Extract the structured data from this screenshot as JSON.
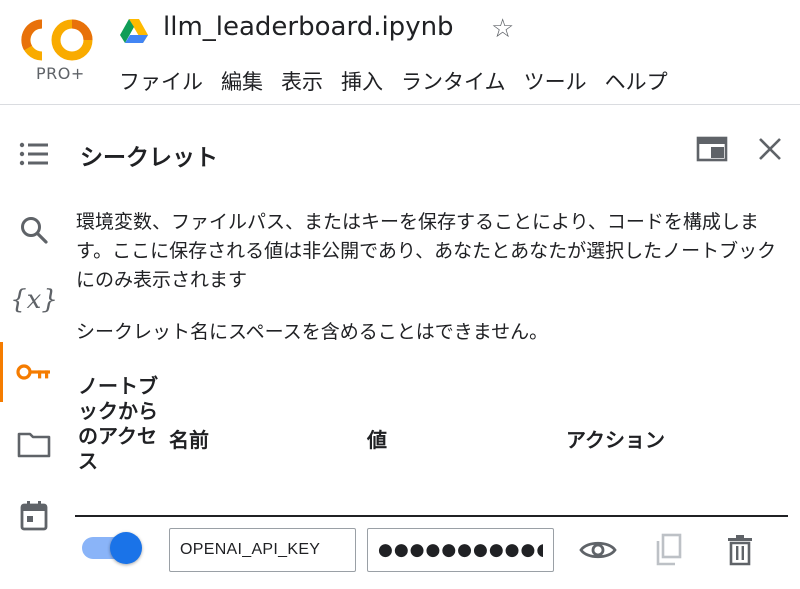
{
  "header": {
    "logo_text": "CO",
    "logo_badge": "PRO+",
    "title": "llm_leaderboard.ipynb",
    "menu": [
      "ファイル",
      "編集",
      "表示",
      "挿入",
      "ランタイム",
      "ツール",
      "ヘルプ"
    ]
  },
  "panel": {
    "title": "シークレット",
    "description": "環境変数、ファイルパス、またはキーを保存することにより、コードを構成します。ここに保存される値は非公開であり、あなたとあなたが選択したノートブックにのみ表示されます",
    "note": "シークレット名にスペースを含めることはできません。"
  },
  "table": {
    "headers": {
      "access": "ノートブックからのアクセス",
      "name": "名前",
      "value": "値",
      "action": "アクション"
    },
    "rows": [
      {
        "access_enabled": true,
        "name": "OPENAI_API_KEY",
        "value_masked": "●●●●●●●●●●●●●●●●●●"
      }
    ]
  },
  "colors": {
    "accent": "#f57c00",
    "toggle_on": "#1a73e8",
    "toggle_track": "#8ab4f8",
    "icon_gray": "#5f6368"
  }
}
